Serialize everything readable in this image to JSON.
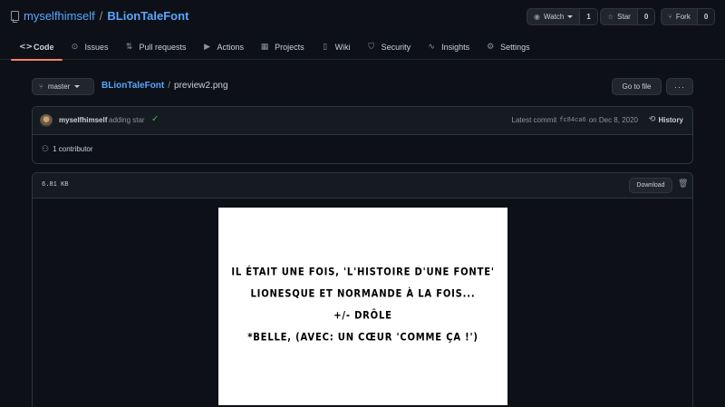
{
  "repo": {
    "owner": "myselfhimself",
    "separator": "/",
    "name": "BLionTaleFont"
  },
  "header_buttons": {
    "watch": {
      "label": "Watch",
      "count": "1",
      "icon": "eye-icon"
    },
    "star": {
      "label": "Star",
      "count": "0",
      "icon": "star-icon"
    },
    "fork": {
      "label": "Fork",
      "count": "0",
      "icon": "fork-icon"
    }
  },
  "tabs": [
    {
      "label": "Code",
      "icon": "code-icon",
      "glyph": "<>"
    },
    {
      "label": "Issues",
      "icon": "issue-icon",
      "glyph": "⊙"
    },
    {
      "label": "Pull requests",
      "icon": "pull-request-icon",
      "glyph": "⇅"
    },
    {
      "label": "Actions",
      "icon": "play-icon",
      "glyph": "▶"
    },
    {
      "label": "Projects",
      "icon": "project-icon",
      "glyph": "▦"
    },
    {
      "label": "Wiki",
      "icon": "book-icon",
      "glyph": "▯"
    },
    {
      "label": "Security",
      "icon": "shield-icon",
      "glyph": "⛉"
    },
    {
      "label": "Insights",
      "icon": "graph-icon",
      "glyph": "∿"
    },
    {
      "label": "Settings",
      "icon": "gear-icon",
      "glyph": "⚙"
    }
  ],
  "breadcrumb": {
    "branch": "master",
    "repo_link": "BLionTaleFont",
    "sep": "/",
    "file": "preview2.png",
    "go_to_file": "Go to file",
    "more": "···"
  },
  "commit": {
    "author": "myselfhimself",
    "message": "adding star",
    "latest_prefix": "Latest commit",
    "sha": "fc84ca6",
    "date": "on Dec 8, 2020",
    "history_label": "History",
    "contributors": "1 contributor"
  },
  "file": {
    "size": "6.81 KB",
    "download_label": "Download"
  },
  "preview_text": [
    "Il était une fois, 'l'histoire d'une fonte'",
    "lionesque et normande à la fois...",
    "+/- drôle",
    "*belle, (avec: un cœur 'comme ça !')"
  ],
  "colors": {
    "background": "#0d1117",
    "link": "#58a6ff",
    "active_tab_underline": "#f78166",
    "success": "#3fb950"
  }
}
